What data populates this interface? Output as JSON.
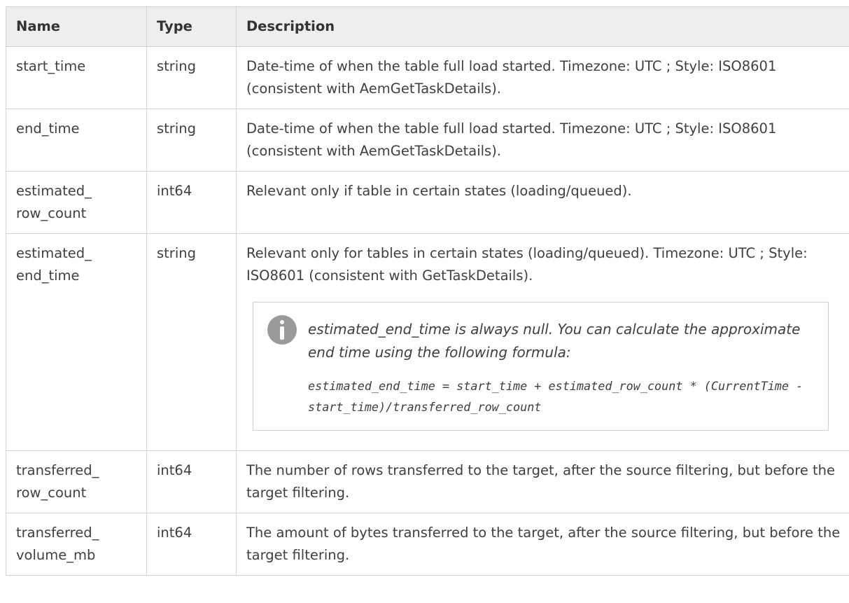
{
  "top_sliver": "",
  "columns": {
    "name": "Name",
    "type": "Type",
    "description": "Description"
  },
  "rows": [
    {
      "name": "start_time",
      "type": "string",
      "description": "Date-time of when the table full load started. Timezone: UTC ; Style: ISO8601 (consistent with AemGetTaskDetails)."
    },
    {
      "name": "end_time",
      "type": "string",
      "description": "Date-time of when the table full load started. Timezone: UTC ; Style: ISO8601 (consistent with AemGetTaskDetails)."
    },
    {
      "name": "estimated_ row_count",
      "type": "int64",
      "description": "Relevant only if table in certain states (loading/queued)."
    },
    {
      "name": "estimated_ end_time",
      "type": "string",
      "description": "Relevant only for tables in certain states (loading/queued). Timezone: UTC ; Style: ISO8601 (consistent with GetTaskDetails).",
      "note": {
        "icon": "info-icon",
        "text": "estimated_end_time is always null. You can calculate the approximate end time using the following formula:",
        "code": "estimated_end_time = start_time + estimated_row_count * (CurrentTime - start_time)/transferred_row_count"
      }
    },
    {
      "name": "transferred_ row_count",
      "type": "int64",
      "description": "The number of rows transferred to the target, after the source filtering, but before the target filtering."
    },
    {
      "name": "transferred_ volume_mb",
      "type": "int64",
      "description": "The amount of bytes transferred to the target, after the source filtering, but before the target filtering."
    }
  ],
  "colors": {
    "header_bg": "#eeeeee",
    "border": "#d4d4d4",
    "text": "#404040",
    "icon": "#9a9a9a"
  }
}
